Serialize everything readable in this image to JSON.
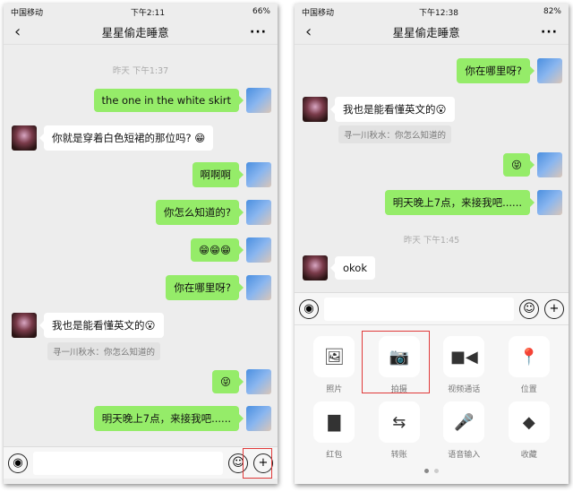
{
  "left": {
    "status": {
      "carrier": "中国移动",
      "time": "下午2:11",
      "battery": "66%"
    },
    "title": "星星偷走睡意",
    "timestamp": "昨天 下午1:37",
    "messages": [
      {
        "side": "sent",
        "text": "the one in the white skirt"
      },
      {
        "side": "recv",
        "text": "你就是穿着白色短裙的那位吗? 😁"
      },
      {
        "side": "sent",
        "text": "啊啊啊"
      },
      {
        "side": "sent",
        "text": "你怎么知道的?"
      },
      {
        "side": "sent",
        "text": "😁😁😁"
      },
      {
        "side": "sent",
        "text": "你在哪里呀?"
      },
      {
        "side": "recv",
        "text": "我也是能看懂英文的😮",
        "quote": "寻一川秋水：你怎么知道的"
      },
      {
        "side": "sent",
        "text": "😝"
      },
      {
        "side": "sent",
        "text": "明天晚上7点，来接我吧......"
      }
    ]
  },
  "right": {
    "status": {
      "carrier": "中国移动",
      "time": "下午12:38",
      "battery": "82%"
    },
    "title": "星星偷走睡意",
    "timestamp": "昨天 下午1:45",
    "messages": [
      {
        "side": "sent",
        "text": "你在哪里呀?"
      },
      {
        "side": "recv",
        "text": "我也是能看懂英文的😮",
        "quote": "寻一川秋水：你怎么知道的"
      },
      {
        "side": "sent",
        "text": "😝"
      },
      {
        "side": "sent",
        "text": "明天晚上7点，来接我吧......"
      },
      {
        "side": "recv",
        "text": "okok"
      }
    ],
    "tools": [
      {
        "label": "照片",
        "icon": "image-icon"
      },
      {
        "label": "拍摄",
        "icon": "camera-icon"
      },
      {
        "label": "视频通话",
        "icon": "video-icon"
      },
      {
        "label": "位置",
        "icon": "location-icon"
      },
      {
        "label": "红包",
        "icon": "red-packet-icon"
      },
      {
        "label": "转账",
        "icon": "transfer-icon"
      },
      {
        "label": "语音输入",
        "icon": "microphone-icon"
      },
      {
        "label": "收藏",
        "icon": "favorites-cube-icon"
      }
    ]
  },
  "icons": {
    "back": "‹",
    "more": "···",
    "voice": "◉",
    "emoji": "☺",
    "plus": "+"
  },
  "colors": {
    "sent_bubble": "#95ec69",
    "highlight": "#e03a3a"
  }
}
